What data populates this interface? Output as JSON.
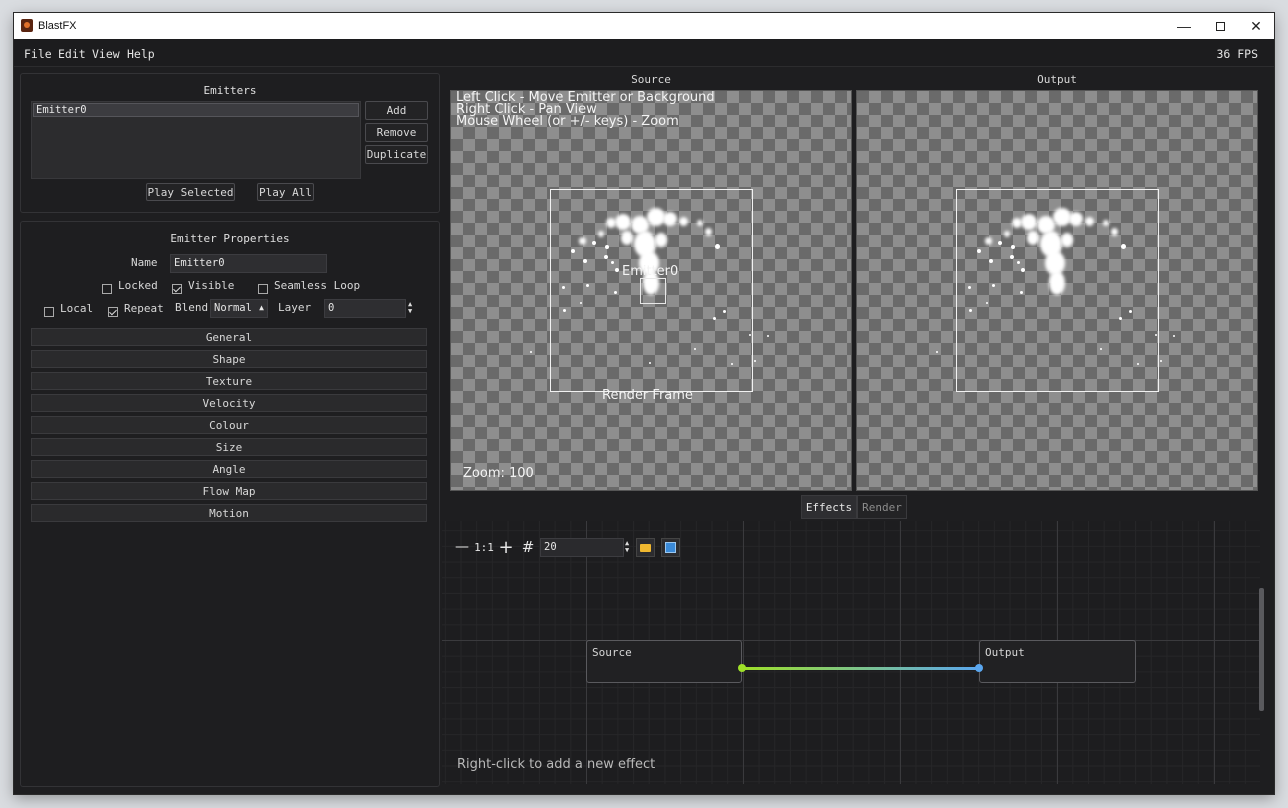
{
  "window": {
    "title": "BlastFX",
    "fps": "36 FPS"
  },
  "menu": [
    "File",
    "Edit",
    "View",
    "Help"
  ],
  "emitters": {
    "title": "Emitters",
    "items": [
      "Emitter0"
    ],
    "add": "Add",
    "remove": "Remove",
    "duplicate": "Duplicate",
    "play_selected": "Play Selected",
    "play_all": "Play All"
  },
  "properties": {
    "title": "Emitter Properties",
    "name_label": "Name",
    "name_value": "Emitter0",
    "locked": {
      "label": "Locked",
      "checked": false
    },
    "visible": {
      "label": "Visible",
      "checked": true
    },
    "seamless_loop": {
      "label": "Seamless Loop",
      "checked": false
    },
    "local": {
      "label": "Local",
      "checked": false
    },
    "repeat": {
      "label": "Repeat",
      "checked": true
    },
    "blend_label": "Blend",
    "blend_value": "Normal",
    "layer_label": "Layer",
    "layer_value": "0",
    "sections": [
      "General",
      "Shape",
      "Texture",
      "Velocity",
      "Colour",
      "Size",
      "Angle",
      "Flow Map",
      "Motion"
    ]
  },
  "source": {
    "label": "Source",
    "help": [
      "Left Click - Move Emitter or Background",
      "Right Click - Pan View",
      "Mouse Wheel (or +/- keys) - Zoom"
    ],
    "emitter_label": "Emitter0",
    "render_frame": "Render Frame",
    "zoom": "Zoom: 100"
  },
  "output": {
    "label": "Output"
  },
  "tabs": {
    "effects": "Effects",
    "render": "Render",
    "active": "Effects"
  },
  "toolbar": {
    "value": "20",
    "icons": [
      "zoom-out-icon",
      "actual-size-icon",
      "zoom-in-icon",
      "grid-icon",
      "folder-icon",
      "save-icon"
    ],
    "one_to_one": "1:1"
  },
  "graph": {
    "nodes": [
      "Source",
      "Output"
    ],
    "hint": "Right-click to add a new effect",
    "colors": {
      "source_pin": "#9ee028",
      "output_pin": "#5aa7f0"
    }
  }
}
